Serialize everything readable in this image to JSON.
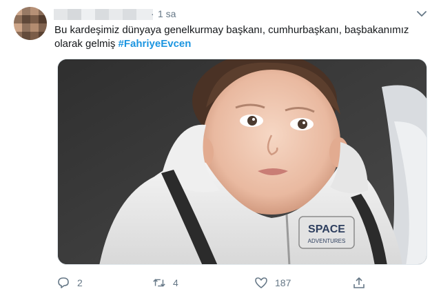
{
  "tweet": {
    "separator": "·",
    "time": "1 sa",
    "text_plain": "Bu kardeşimiz dünyaya genelkurmay başkanı, cumhurbaşkanı, başbakanımız olarak gelmiş ",
    "hashtag": "#FahriyeEvcen",
    "media": {
      "alt": "",
      "print_brand": "SPACE",
      "print_sub": "ADVENTURES"
    }
  },
  "actions": {
    "reply": {
      "icon": "reply-icon",
      "count": "2"
    },
    "retweet": {
      "icon": "retweet-icon",
      "count": "4"
    },
    "like": {
      "icon": "heart-icon",
      "count": "187"
    },
    "share": {
      "icon": "share-icon",
      "count": ""
    }
  },
  "colors": {
    "text": "#14171a",
    "secondary": "#657786",
    "link": "#1b95e0",
    "border": "#e1e8ed"
  }
}
